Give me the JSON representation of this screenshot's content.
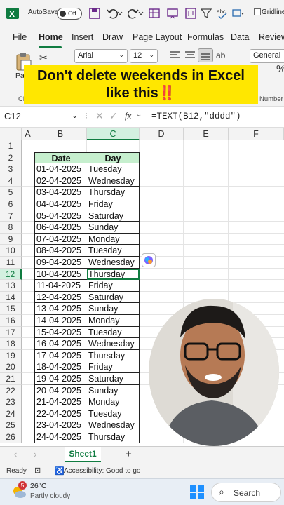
{
  "qat": {
    "autosave_label": "AutoSave",
    "autosave_state": "Off",
    "gridlines_label": "Gridline"
  },
  "tabs": [
    "File",
    "Home",
    "Insert",
    "Draw",
    "Page Layout",
    "Formulas",
    "Data",
    "Review"
  ],
  "ribbon": {
    "font_name": "Arial",
    "font_size": "12",
    "number_format": "General",
    "paste_label": "Pas",
    "clip_label": "Cli",
    "number_label": "Number",
    "percent": "%"
  },
  "banner": {
    "line1": "Don't delete weekends in Excel",
    "line2": "like this",
    "emoji": "‼️"
  },
  "formula_bar": {
    "name_box": "C12",
    "fx": "fx",
    "formula": "=TEXT(B12,\"dddd\")"
  },
  "columns": [
    "A",
    "B",
    "C",
    "D",
    "E",
    "F"
  ],
  "row_numbers": [
    "1",
    "2",
    "3",
    "4",
    "5",
    "6",
    "7",
    "8",
    "9",
    "10",
    "11",
    "12",
    "13",
    "14",
    "15",
    "16",
    "17",
    "18",
    "19",
    "20",
    "21",
    "22",
    "23",
    "24",
    "25",
    "26"
  ],
  "table": {
    "headers": [
      "Date",
      "Day"
    ],
    "rows": [
      [
        "01-04-2025",
        "Tuesday"
      ],
      [
        "02-04-2025",
        "Wednesday"
      ],
      [
        "03-04-2025",
        "Thursday"
      ],
      [
        "04-04-2025",
        "Friday"
      ],
      [
        "05-04-2025",
        "Saturday"
      ],
      [
        "06-04-2025",
        "Sunday"
      ],
      [
        "07-04-2025",
        "Monday"
      ],
      [
        "08-04-2025",
        "Tuesday"
      ],
      [
        "09-04-2025",
        "Wednesday"
      ],
      [
        "10-04-2025",
        "Thursday"
      ],
      [
        "11-04-2025",
        "Friday"
      ],
      [
        "12-04-2025",
        "Saturday"
      ],
      [
        "13-04-2025",
        "Sunday"
      ],
      [
        "14-04-2025",
        "Monday"
      ],
      [
        "15-04-2025",
        "Tuesday"
      ],
      [
        "16-04-2025",
        "Wednesday"
      ],
      [
        "17-04-2025",
        "Thursday"
      ],
      [
        "18-04-2025",
        "Friday"
      ],
      [
        "19-04-2025",
        "Saturday"
      ],
      [
        "20-04-2025",
        "Sunday"
      ],
      [
        "21-04-2025",
        "Monday"
      ],
      [
        "22-04-2025",
        "Tuesday"
      ],
      [
        "23-04-2025",
        "Wednesday"
      ],
      [
        "24-04-2025",
        "Thursday"
      ]
    ]
  },
  "sheet": {
    "tab": "Sheet1",
    "add": "+"
  },
  "status": {
    "ready": "Ready",
    "accessibility": "Accessibility: Good to go"
  },
  "taskbar": {
    "badge": "5",
    "temp": "26°C",
    "weather": "Partly cloudy",
    "search": "Search"
  },
  "colors": {
    "accent": "#107c41",
    "header_fill": "#c6efce",
    "banner": "#ffe700"
  }
}
